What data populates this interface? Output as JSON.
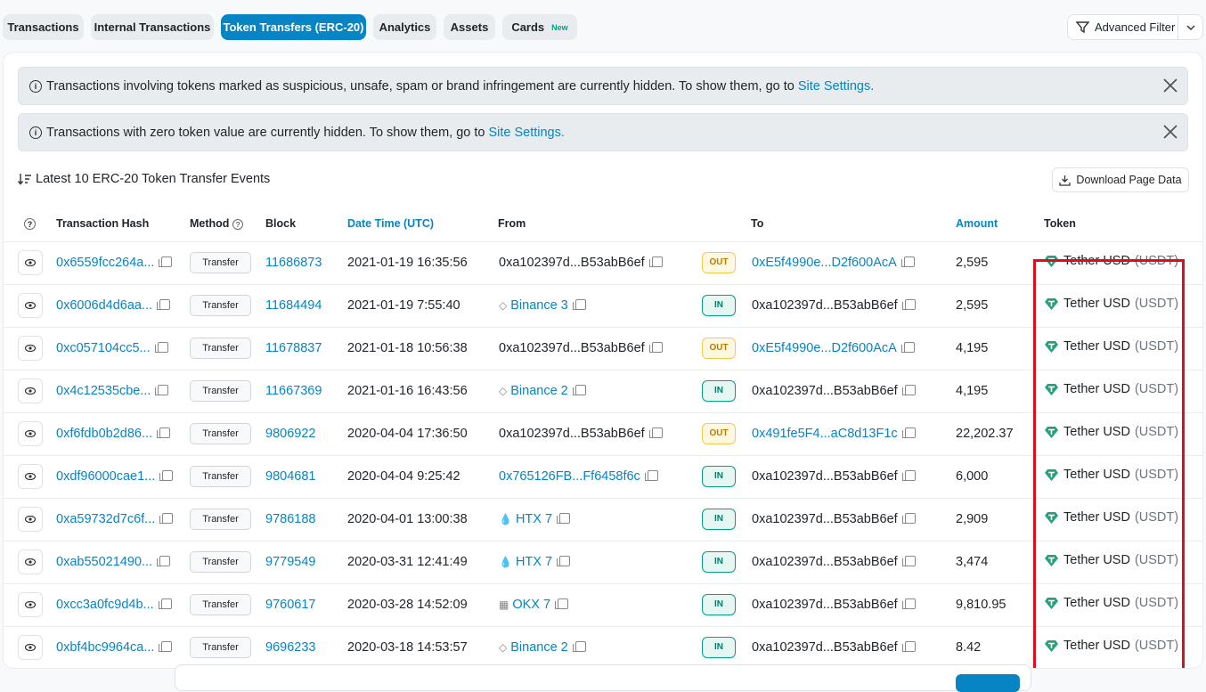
{
  "tabs": [
    {
      "label": "Transactions",
      "active": false
    },
    {
      "label": "Internal Transactions",
      "active": false
    },
    {
      "label": "Token Transfers (ERC-20)",
      "active": true
    },
    {
      "label": "Analytics",
      "active": false
    },
    {
      "label": "Assets",
      "active": false
    },
    {
      "label": "Cards",
      "active": false,
      "badge": "New"
    }
  ],
  "advanced_filter": {
    "label": "Advanced Filter"
  },
  "alerts": [
    {
      "text": "Transactions involving tokens marked as suspicious, unsafe, spam or brand infringement are currently hidden. To show them, go to",
      "link": "Site Settings."
    },
    {
      "text": "Transactions with zero token value are currently hidden. To show them, go to",
      "link": "Site Settings."
    }
  ],
  "list_title": "Latest 10 ERC-20 Token Transfer Events",
  "download_label": "Download Page Data",
  "columns": {
    "hash": "Transaction Hash",
    "method": "Method",
    "block": "Block",
    "datetime": "Date Time (UTC)",
    "from": "From",
    "to": "To",
    "amount": "Amount",
    "token": "Token"
  },
  "rows": [
    {
      "hash": "0x6559fcc264a...",
      "method": "Transfer",
      "block": "11686873",
      "datetime": "2021-01-19 16:35:56",
      "from": "0xa102397d...B53abB6ef",
      "from_link": false,
      "from_icon": "",
      "dir": "OUT",
      "to": "0xE5f4990e...D2f600AcA",
      "to_link": true,
      "amount": "2,595",
      "token": "Tether USD",
      "symbol": "(USDT)"
    },
    {
      "hash": "0x6006d4d6aa...",
      "method": "Transfer",
      "block": "11684494",
      "datetime": "2021-01-19 7:55:40",
      "from": "Binance 3",
      "from_link": true,
      "from_icon": "binance-icon",
      "dir": "IN",
      "to": "0xa102397d...B53abB6ef",
      "to_link": false,
      "amount": "2,595",
      "token": "Tether USD",
      "symbol": "(USDT)"
    },
    {
      "hash": "0xc057104cc5...",
      "method": "Transfer",
      "block": "11678837",
      "datetime": "2021-01-18 10:56:38",
      "from": "0xa102397d...B53abB6ef",
      "from_link": false,
      "from_icon": "",
      "dir": "OUT",
      "to": "0xE5f4990e...D2f600AcA",
      "to_link": true,
      "amount": "4,195",
      "token": "Tether USD",
      "symbol": "(USDT)"
    },
    {
      "hash": "0x4c12535cbe...",
      "method": "Transfer",
      "block": "11667369",
      "datetime": "2021-01-16 16:43:56",
      "from": "Binance 2",
      "from_link": true,
      "from_icon": "binance-icon",
      "dir": "IN",
      "to": "0xa102397d...B53abB6ef",
      "to_link": false,
      "amount": "4,195",
      "token": "Tether USD",
      "symbol": "(USDT)"
    },
    {
      "hash": "0xf6fdb0b2d86...",
      "method": "Transfer",
      "block": "9806922",
      "datetime": "2020-04-04 17:36:50",
      "from": "0xa102397d...B53abB6ef",
      "from_link": false,
      "from_icon": "",
      "dir": "OUT",
      "to": "0x491fe5F4...aC8d13F1c",
      "to_link": true,
      "amount": "22,202.37",
      "token": "Tether USD",
      "symbol": "(USDT)"
    },
    {
      "hash": "0xdf96000cae1...",
      "method": "Transfer",
      "block": "9804681",
      "datetime": "2020-04-04 9:25:42",
      "from": "0x765126FB...Ff6458f6c",
      "from_link": true,
      "from_icon": "",
      "dir": "IN",
      "to": "0xa102397d...B53abB6ef",
      "to_link": false,
      "amount": "6,000",
      "token": "Tether USD",
      "symbol": "(USDT)"
    },
    {
      "hash": "0xa59732d7c6f...",
      "method": "Transfer",
      "block": "9786188",
      "datetime": "2020-04-01 13:00:38",
      "from": "HTX 7",
      "from_link": true,
      "from_icon": "htx-icon",
      "dir": "IN",
      "to": "0xa102397d...B53abB6ef",
      "to_link": false,
      "amount": "2,909",
      "token": "Tether USD",
      "symbol": "(USDT)"
    },
    {
      "hash": "0xab55021490...",
      "method": "Transfer",
      "block": "9779549",
      "datetime": "2020-03-31 12:41:49",
      "from": "HTX 7",
      "from_link": true,
      "from_icon": "htx-icon",
      "dir": "IN",
      "to": "0xa102397d...B53abB6ef",
      "to_link": false,
      "amount": "3,474",
      "token": "Tether USD",
      "symbol": "(USDT)"
    },
    {
      "hash": "0xcc3a0fc9d4b...",
      "method": "Transfer",
      "block": "9760617",
      "datetime": "2020-03-28 14:52:09",
      "from": "OKX 7",
      "from_link": true,
      "from_icon": "okx-icon",
      "dir": "IN",
      "to": "0xa102397d...B53abB6ef",
      "to_link": false,
      "amount": "9,810.95",
      "token": "Tether USD",
      "symbol": "(USDT)"
    },
    {
      "hash": "0xbf4bc9964ca...",
      "method": "Transfer",
      "block": "9696233",
      "datetime": "2020-03-18 14:53:57",
      "from": "Binance 2",
      "from_link": true,
      "from_icon": "binance-icon",
      "dir": "IN",
      "to": "0xa102397d...B53abB6ef",
      "to_link": false,
      "amount": "8.42",
      "token": "Tether USD",
      "symbol": "(USDT)"
    }
  ],
  "colors": {
    "accent": "#0784c3",
    "highlight": "#e00b1c",
    "tether": "#26a17b"
  }
}
